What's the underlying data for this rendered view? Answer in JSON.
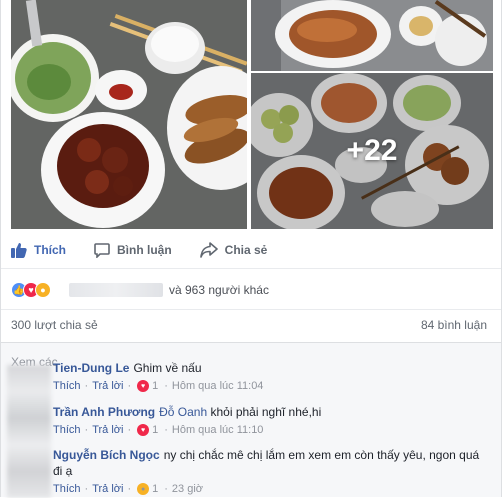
{
  "photos": {
    "more_count": "+22"
  },
  "actions": {
    "like": "Thích",
    "comment": "Bình luận",
    "share": "Chia sẻ"
  },
  "reactions": {
    "others_text": "và 963 người khác"
  },
  "stats": {
    "shares": "300 lượt chia sẻ",
    "comments": "84 bình luận"
  },
  "comments": {
    "view_previous": "Xem các",
    "items": [
      {
        "author": "Tien-Dung Le",
        "tag": "",
        "text": "Ghim về nấu",
        "like_label": "Thích",
        "reply_label": "Trả lời",
        "reaction_count": "1",
        "time": "Hôm qua lúc 11:04"
      },
      {
        "author": "Trần Anh Phương",
        "tag": "Đỗ Oanh",
        "text": "khỏi phải nghĩ nhé,hi",
        "like_label": "Thích",
        "reply_label": "Trả lời",
        "reaction_count": "1",
        "time": "Hôm qua lúc 11:10"
      },
      {
        "author": "Nguyễn Bích Ngọc",
        "tag": "",
        "text": "ny chị chắc mê chị lắm em xem em còn thấy yêu, ngon quá đi ạ",
        "like_label": "Thích",
        "reply_label": "Trả lời",
        "reaction_count": "1",
        "time": "23 giờ"
      }
    ]
  },
  "colors": {
    "brand": "#4267b2",
    "link": "#385898",
    "muted": "#90949c"
  }
}
